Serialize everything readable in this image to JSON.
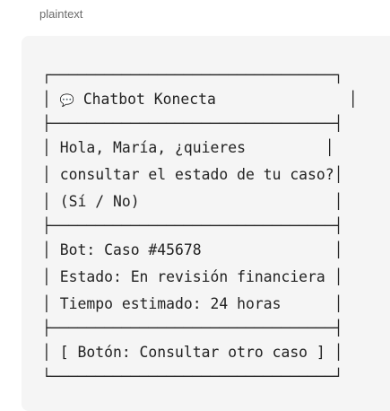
{
  "code_block": {
    "language": "plaintext",
    "icon": "speech-bubble-icon",
    "title": "Chatbot Konecta",
    "greeting": [
      "Hola, María, ¿quieres",
      "consultar el estado de tu caso?",
      "(Sí / No)"
    ],
    "bot_lines": [
      "Bot: Caso #45678",
      "Estado: En revisión financiera",
      "Tiempo estimado: 24 horas"
    ],
    "button_text": "[ Botón: Consultar otro caso ]",
    "border_top": "┌────────────────────────────────┐",
    "border_mid": "├────────────────────────────────┤",
    "border_bottom": "└────────────────────────────────┘"
  }
}
